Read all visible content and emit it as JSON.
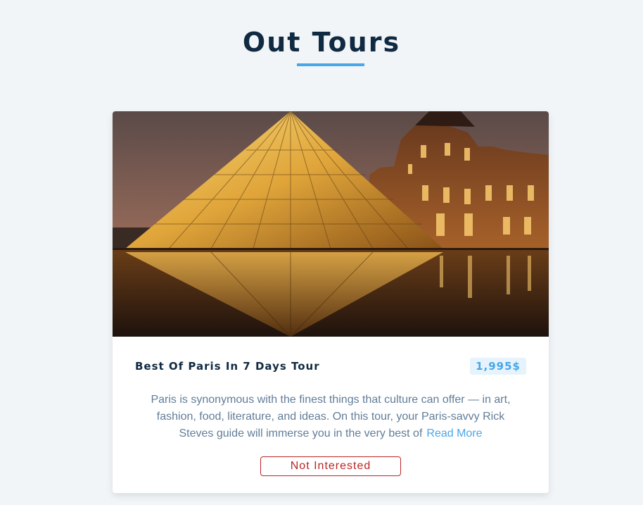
{
  "page": {
    "title": "Out Tours"
  },
  "tour": {
    "name": "Best Of Paris In 7 Days Tour",
    "price": "1,995$",
    "info": "Paris is synonymous with the finest things that culture can offer — in art, fashion, food, literature, and ideas. On this tour, your Paris-savvy Rick Steves guide will immerse you in the very best of",
    "read_more_label": "Read More",
    "not_interested_label": "Not Interested"
  },
  "colors": {
    "title": "#102a42",
    "accent": "#49a6e9",
    "danger": "#bb2525",
    "body_text": "#617d98",
    "background": "#f1f5f8"
  }
}
